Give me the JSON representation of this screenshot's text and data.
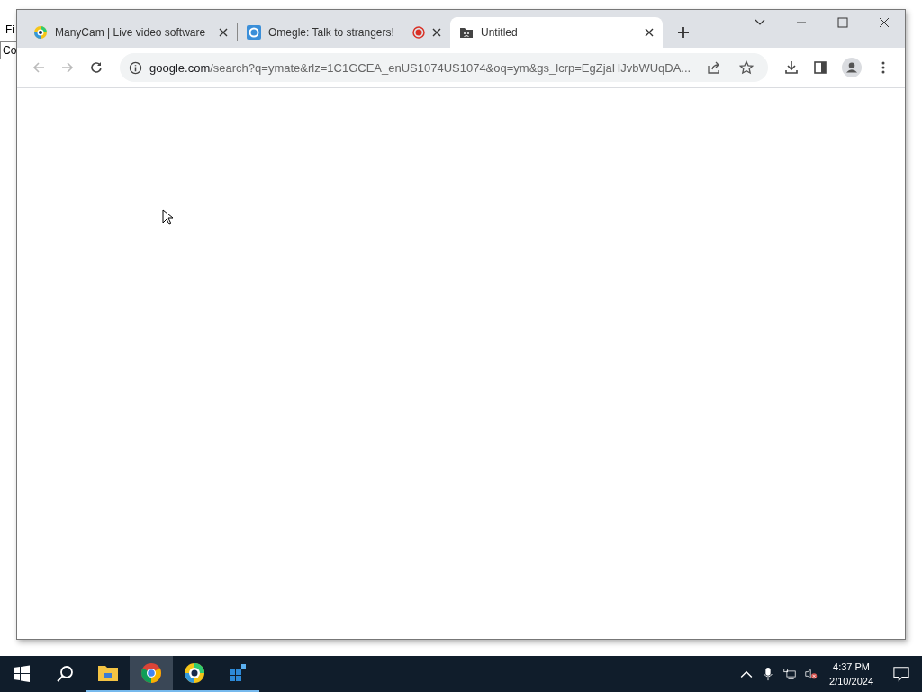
{
  "background_window": {
    "menu_fragment": "Fi",
    "address_fragment": "Co"
  },
  "browser": {
    "tabs": [
      {
        "title": "ManyCam | Live video software",
        "kind": "manycam",
        "recording": false,
        "selected": false
      },
      {
        "title": "Omegle: Talk to strangers!",
        "kind": "omegle",
        "recording": true,
        "selected": false
      },
      {
        "title": "Untitled",
        "kind": "sad",
        "recording": false,
        "selected": true
      }
    ],
    "address": {
      "host": "google.com",
      "path": "/search?q=ymate&rlz=1C1GCEA_enUS1074US1074&oq=ym&gs_lcrp=EgZjaHJvbWUqDA..."
    }
  },
  "taskbar": {
    "apps": [
      {
        "kind": "explorer",
        "selected": false
      },
      {
        "kind": "chrome",
        "selected": true
      },
      {
        "kind": "manycam",
        "selected": false
      },
      {
        "kind": "registry",
        "selected": false
      }
    ],
    "time": "4:37 PM",
    "date": "2/10/2024"
  }
}
